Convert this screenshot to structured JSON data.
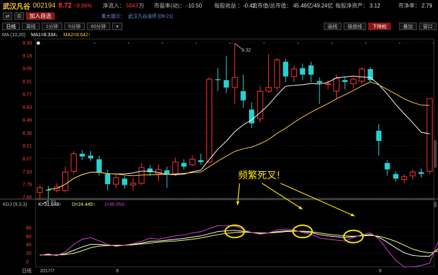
{
  "header": {
    "stock_name": "武汉凡谷",
    "stock_code": "002194",
    "price": "8.72",
    "change_pct": "9.96%",
    "stats": [
      {
        "label": "净流入：",
        "value": "5843",
        "unit": "万"
      },
      {
        "label": "市盈率(动)：",
        "value": "-10.50"
      },
      {
        "label": "每股收益",
        "value": "：-0.41"
      },
      {
        "label": "流市值/总市值：",
        "value": "45.48亿/49.24亿"
      },
      {
        "label": "每股净资产：",
        "value": "3.12"
      },
      {
        "label": "市净率：",
        "value": "2.79"
      }
    ],
    "add_watch_label": "加入自选",
    "notice_label": "重大提示：",
    "notice_text": "武汉凡谷涨停 [09-21]"
  },
  "period_tabs": [
    {
      "label": "日线",
      "active": true
    },
    {
      "label": "周线",
      "active": false
    },
    {
      "label": "1分钟",
      "active": false
    },
    {
      "label": "5分钟",
      "active": false
    },
    {
      "label": "60分钟",
      "active": false
    }
  ],
  "right_tabs": [
    {
      "label": "画线",
      "active": false
    },
    {
      "label": "操盘线",
      "active": false
    },
    {
      "label": "下除权",
      "active": true
    },
    {
      "label": "叠加",
      "active": false
    },
    {
      "label": "窗口",
      "active": false
    }
  ],
  "ma_legend": {
    "title": "MA (10,20)",
    "ma1": "MA1=8.334↓",
    "ma2": "MA2=8.642↑"
  },
  "kdj_legend": {
    "title": "KDJ (9,3,3)",
    "k": "K=31.648↑",
    "d": "D=24.445↑",
    "j": "J=46.053↑"
  },
  "annotation": "频繁死叉!",
  "colors": {
    "up": "#ff3333",
    "down": "#2ad0d0",
    "ma1": "#ffffff",
    "ma2": "#ffcc33",
    "k": "#ffffff",
    "d": "#ffff66",
    "j": "#cc44cc",
    "annotation": "#ffe600"
  },
  "chart_data": [
    {
      "type": "candlestick",
      "price_labels": [
        "9.33",
        "9.19",
        "9.05",
        "8.91",
        "8.77",
        "8.63",
        "8.49",
        "8.35",
        "8.21",
        "8.07",
        "7.93",
        "7.79",
        "7.65"
      ],
      "ylim": [
        7.65,
        9.33
      ],
      "max_label": "9.32",
      "min_label": "7.61",
      "candles": [
        {
          "o": 7.7,
          "c": 7.75,
          "h": 7.78,
          "l": 7.63
        },
        {
          "o": 7.73,
          "c": 7.72,
          "h": 7.77,
          "l": 7.61
        },
        {
          "o": 7.72,
          "c": 7.76,
          "h": 7.8,
          "l": 7.7
        },
        {
          "o": 7.72,
          "c": 7.92,
          "h": 7.98,
          "l": 7.7
        },
        {
          "o": 7.93,
          "c": 8.12,
          "h": 8.15,
          "l": 7.9
        },
        {
          "o": 8.12,
          "c": 8.09,
          "h": 8.16,
          "l": 8.05
        },
        {
          "o": 8.1,
          "c": 8.07,
          "h": 8.15,
          "l": 8.04
        },
        {
          "o": 8.06,
          "c": 7.92,
          "h": 8.1,
          "l": 7.88
        },
        {
          "o": 7.9,
          "c": 7.79,
          "h": 7.95,
          "l": 7.72
        },
        {
          "o": 7.79,
          "c": 7.86,
          "h": 7.9,
          "l": 7.75
        },
        {
          "o": 7.85,
          "c": 7.78,
          "h": 7.88,
          "l": 7.74
        },
        {
          "o": 7.78,
          "c": 7.8,
          "h": 7.86,
          "l": 7.72
        },
        {
          "o": 7.8,
          "c": 7.97,
          "h": 8.02,
          "l": 7.78
        },
        {
          "o": 7.96,
          "c": 7.92,
          "h": 8.0,
          "l": 7.88
        },
        {
          "o": 7.9,
          "c": 7.95,
          "h": 8.0,
          "l": 7.82
        },
        {
          "o": 7.94,
          "c": 7.9,
          "h": 7.98,
          "l": 7.75
        },
        {
          "o": 7.9,
          "c": 8.03,
          "h": 8.08,
          "l": 7.88
        },
        {
          "o": 8.02,
          "c": 7.98,
          "h": 8.06,
          "l": 7.95
        },
        {
          "o": 8.0,
          "c": 8.06,
          "h": 8.1,
          "l": 7.98
        },
        {
          "o": 8.05,
          "c": 8.03,
          "h": 8.12,
          "l": 8.0
        },
        {
          "o": 8.03,
          "c": 8.93,
          "h": 8.95,
          "l": 8.02
        },
        {
          "o": 8.93,
          "c": 8.92,
          "h": 9.05,
          "l": 8.8
        },
        {
          "o": 8.92,
          "c": 8.84,
          "h": 9.18,
          "l": 8.78
        },
        {
          "o": 8.84,
          "c": 8.95,
          "h": 9.32,
          "l": 8.66
        },
        {
          "o": 8.8,
          "c": 8.7,
          "h": 8.98,
          "l": 8.62
        },
        {
          "o": 8.6,
          "c": 8.45,
          "h": 8.68,
          "l": 8.4
        },
        {
          "o": 8.5,
          "c": 8.8,
          "h": 8.86,
          "l": 8.46
        },
        {
          "o": 8.8,
          "c": 8.84,
          "h": 9.2,
          "l": 8.78
        },
        {
          "o": 8.84,
          "c": 9.14,
          "h": 9.16,
          "l": 8.8
        },
        {
          "o": 9.12,
          "c": 8.96,
          "h": 9.15,
          "l": 8.9
        },
        {
          "o": 8.96,
          "c": 9.04,
          "h": 9.08,
          "l": 8.9
        },
        {
          "o": 9.05,
          "c": 8.98,
          "h": 9.1,
          "l": 8.92
        },
        {
          "o": 9.08,
          "c": 8.98,
          "h": 9.12,
          "l": 8.9
        },
        {
          "o": 8.91,
          "c": 8.89,
          "h": 8.95,
          "l": 8.66
        },
        {
          "o": 8.88,
          "c": 8.88,
          "h": 8.92,
          "l": 8.82
        },
        {
          "o": 8.8,
          "c": 8.94,
          "h": 8.98,
          "l": 8.72
        },
        {
          "o": 8.92,
          "c": 8.9,
          "h": 8.96,
          "l": 8.82
        },
        {
          "o": 8.88,
          "c": 8.93,
          "h": 8.95,
          "l": 8.83
        },
        {
          "o": 8.91,
          "c": 9.04,
          "h": 9.06,
          "l": 8.88
        },
        {
          "o": 9.04,
          "c": 8.92,
          "h": 9.06,
          "l": 8.9
        },
        {
          "o": 8.37,
          "c": 8.26,
          "h": 8.44,
          "l": 8.1
        },
        {
          "o": 8.02,
          "c": 7.95,
          "h": 8.05,
          "l": 7.88
        },
        {
          "o": 7.9,
          "c": 7.85,
          "h": 7.93,
          "l": 7.82
        },
        {
          "o": 7.84,
          "c": 7.87,
          "h": 7.9,
          "l": 7.8
        },
        {
          "o": 7.88,
          "c": 7.92,
          "h": 7.95,
          "l": 7.84
        },
        {
          "o": 7.92,
          "c": 7.9,
          "h": 7.96,
          "l": 7.86
        },
        {
          "o": 7.93,
          "c": 8.72,
          "h": 8.72,
          "l": 7.9
        }
      ]
    },
    {
      "type": "line",
      "ylim": [
        0,
        100
      ],
      "y_ticks": [
        "80",
        "60",
        "40",
        "20",
        "0"
      ],
      "x_labels": [
        {
          "label": "2017/7",
          "index": 0
        },
        {
          "label": "8",
          "index": 9
        },
        {
          "label": "9",
          "index": 40
        }
      ],
      "series": [
        {
          "name": "K",
          "values": [
            15,
            16,
            15,
            18,
            26,
            34,
            40,
            40,
            38,
            37,
            38,
            40,
            43,
            47,
            48,
            50,
            52,
            54,
            57,
            60,
            65,
            70,
            72,
            73,
            71,
            68,
            66,
            67,
            70,
            72,
            72,
            70,
            68,
            63,
            60,
            58,
            56,
            58,
            61,
            63,
            57,
            45,
            32,
            20,
            14,
            12,
            12,
            30
          ]
        },
        {
          "name": "D",
          "values": [
            15,
            15,
            15,
            16,
            19,
            25,
            32,
            36,
            37,
            38,
            38,
            39,
            41,
            43,
            45,
            47,
            48,
            50,
            52,
            55,
            59,
            63,
            66,
            68,
            69,
            68,
            67,
            67,
            68,
            70,
            71,
            71,
            70,
            67,
            64,
            62,
            60,
            59,
            60,
            61,
            59,
            54,
            47,
            38,
            29,
            23,
            20,
            24
          ]
        },
        {
          "name": "J",
          "values": [
            14,
            18,
            13,
            22,
            40,
            52,
            56,
            48,
            40,
            35,
            38,
            42,
            47,
            55,
            52,
            56,
            60,
            62,
            67,
            70,
            77,
            84,
            84,
            83,
            75,
            68,
            64,
            67,
            74,
            76,
            74,
            68,
            64,
            55,
            52,
            50,
            48,
            56,
            63,
            67,
            53,
            27,
            2,
            -16,
            -16,
            -10,
            -4,
            46
          ]
        }
      ]
    }
  ]
}
